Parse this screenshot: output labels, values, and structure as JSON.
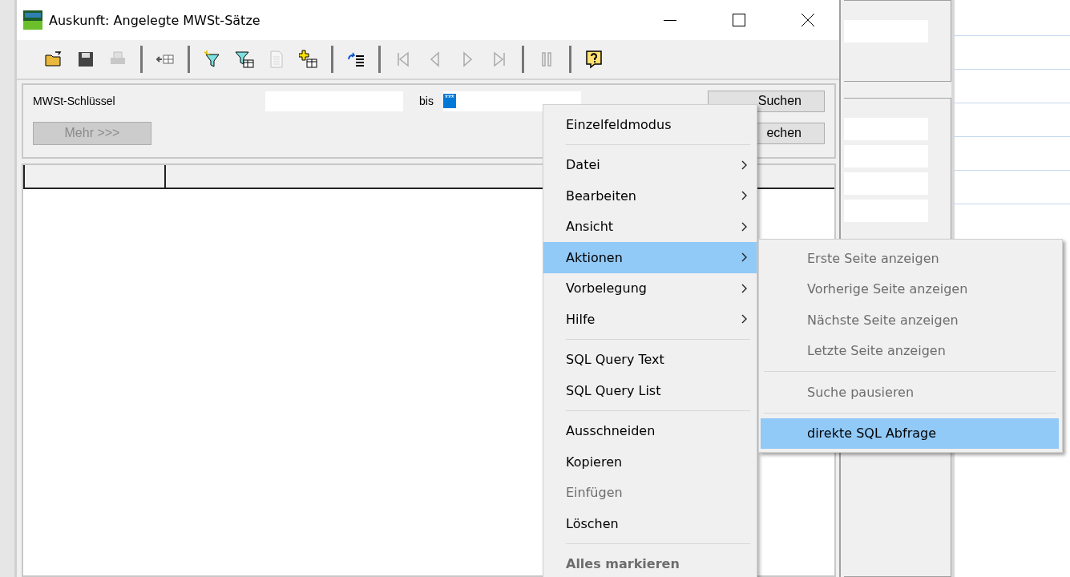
{
  "window": {
    "title": "Auskunft:  Angelegte MWSt-Sätze"
  },
  "toolbar": [
    {
      "kind": "open",
      "disabled": false
    },
    {
      "kind": "save",
      "disabled": false
    },
    {
      "kind": "print",
      "disabled": true
    },
    {
      "kind": "separator"
    },
    {
      "kind": "insert",
      "disabled": false
    },
    {
      "kind": "separator"
    },
    {
      "kind": "filter-new",
      "disabled": false
    },
    {
      "kind": "filter-table",
      "disabled": false
    },
    {
      "kind": "document",
      "disabled": true
    },
    {
      "kind": "add-table",
      "disabled": false
    },
    {
      "kind": "separator"
    },
    {
      "kind": "list",
      "disabled": false
    },
    {
      "kind": "separator"
    },
    {
      "kind": "first",
      "disabled": true
    },
    {
      "kind": "prev",
      "disabled": true
    },
    {
      "kind": "next",
      "disabled": true
    },
    {
      "kind": "last",
      "disabled": true
    },
    {
      "kind": "separator"
    },
    {
      "kind": "pause",
      "disabled": true
    },
    {
      "kind": "separator"
    },
    {
      "kind": "help",
      "disabled": false
    }
  ],
  "search": {
    "label": "MWSt-Schlüssel",
    "between": "bis",
    "to_value": "***",
    "more_button": {
      "label": "Mehr >>>",
      "disabled": true
    },
    "buttons": [
      "Suchen",
      "echen"
    ]
  },
  "context_menu": [
    {
      "kind": "item",
      "label": "Einzelfeldmodus",
      "submenu": false,
      "disabled": false,
      "selected": false
    },
    {
      "kind": "separator"
    },
    {
      "kind": "item",
      "label": "Datei",
      "submenu": true,
      "disabled": false,
      "selected": false
    },
    {
      "kind": "item",
      "label": "Bearbeiten",
      "submenu": true,
      "disabled": false,
      "selected": false
    },
    {
      "kind": "item",
      "label": "Ansicht",
      "submenu": true,
      "disabled": false,
      "selected": false
    },
    {
      "kind": "item",
      "label": "Aktionen",
      "submenu": true,
      "disabled": false,
      "selected": true
    },
    {
      "kind": "item",
      "label": "Vorbelegung",
      "submenu": true,
      "disabled": false,
      "selected": false
    },
    {
      "kind": "item",
      "label": "Hilfe",
      "submenu": true,
      "disabled": false,
      "selected": false
    },
    {
      "kind": "separator"
    },
    {
      "kind": "item",
      "label": "SQL Query Text",
      "submenu": false,
      "disabled": false,
      "selected": false
    },
    {
      "kind": "item",
      "label": "SQL Query List",
      "submenu": false,
      "disabled": false,
      "selected": false
    },
    {
      "kind": "separator"
    },
    {
      "kind": "item",
      "label": "Ausschneiden",
      "submenu": false,
      "disabled": false,
      "selected": false
    },
    {
      "kind": "item",
      "label": "Kopieren",
      "submenu": false,
      "disabled": false,
      "selected": false
    },
    {
      "kind": "item",
      "label": "Einfügen",
      "submenu": false,
      "disabled": true,
      "selected": false
    },
    {
      "kind": "item",
      "label": "Löschen",
      "submenu": false,
      "disabled": false,
      "selected": false
    },
    {
      "kind": "separator"
    },
    {
      "kind": "item",
      "label": "Alles markieren",
      "submenu": false,
      "disabled": true,
      "selected": false,
      "default": true
    }
  ],
  "submenu": [
    {
      "kind": "item",
      "label": "Erste Seite anzeigen",
      "disabled": true,
      "selected": false
    },
    {
      "kind": "item",
      "label": "Vorherige Seite anzeigen",
      "disabled": true,
      "selected": false
    },
    {
      "kind": "item",
      "label": "Nächste Seite anzeigen",
      "disabled": true,
      "selected": false
    },
    {
      "kind": "item",
      "label": "Letzte Seite anzeigen",
      "disabled": true,
      "selected": false
    },
    {
      "kind": "separator"
    },
    {
      "kind": "item",
      "label": "Suche pausieren",
      "disabled": true,
      "selected": false
    },
    {
      "kind": "separator"
    },
    {
      "kind": "item",
      "label": "direkte SQL Abfrage",
      "disabled": false,
      "selected": true
    }
  ]
}
